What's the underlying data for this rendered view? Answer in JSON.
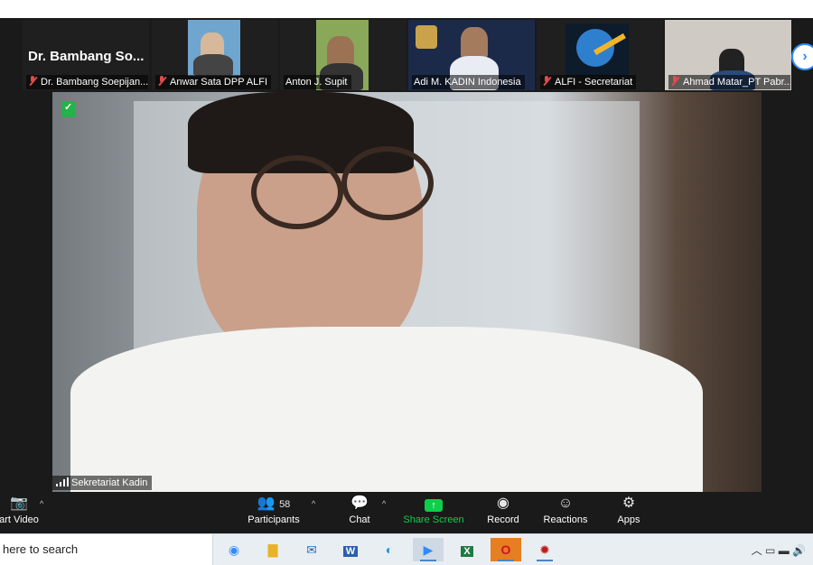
{
  "gallery": {
    "tiles": [
      {
        "name": "Dr. Bambang Soepijan...",
        "big_label": "Dr. Bambang So...",
        "muted": true
      },
      {
        "name": "Anwar Sata DPP ALFI",
        "muted": true
      },
      {
        "name": "Anton J. Supit",
        "muted": false
      },
      {
        "name": "Adi M. KADIN Indonesia",
        "muted": false
      },
      {
        "name": "ALFI - Secretariat",
        "muted": true
      },
      {
        "name": "Ahmad Matar_PT Pabr...",
        "muted": true
      }
    ],
    "next_icon": "chevron-right-icon"
  },
  "main_video": {
    "speaker": "Sekretariat Kadin",
    "encryption_icon": "shield-check-icon"
  },
  "toolbar": {
    "start_video": "art Video",
    "participants": "Participants",
    "participants_count": "58",
    "chat": "Chat",
    "share_screen": "Share Screen",
    "record": "Record",
    "reactions": "Reactions",
    "apps": "Apps"
  },
  "taskbar": {
    "search_placeholder": "here to search",
    "apps": [
      "zoom-meeting-icon",
      "file-explorer-icon",
      "mail-icon",
      "word-icon",
      "edge-icon",
      "zoom-icon",
      "excel-icon",
      "opera-icon",
      "game-icon"
    ]
  },
  "colors": {
    "share_green": "#0ccf4c",
    "muted_red": "#e24a4a",
    "accent_blue": "#2d8cff"
  }
}
